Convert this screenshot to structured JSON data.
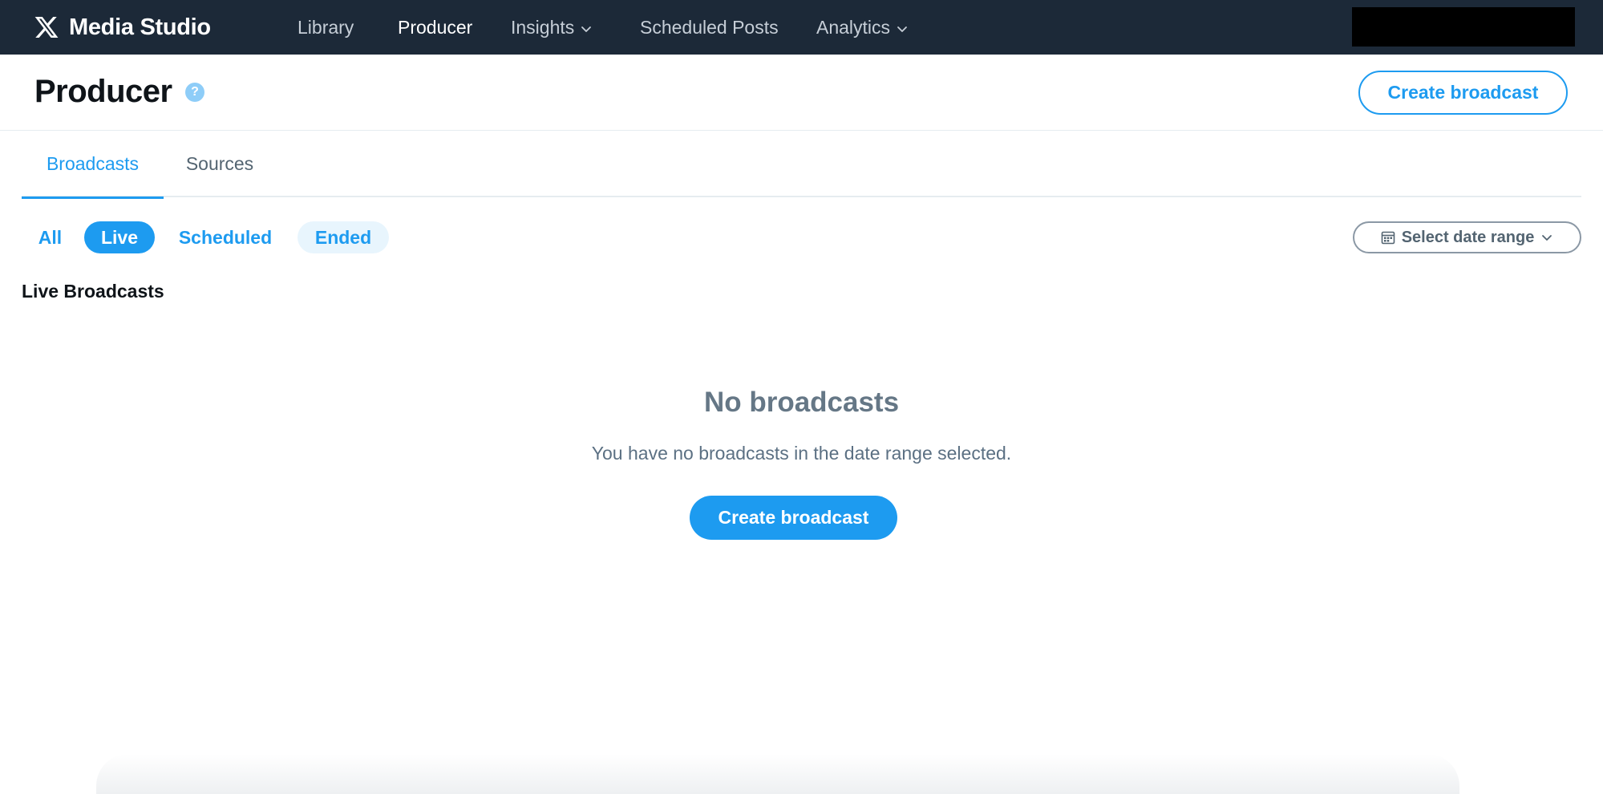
{
  "topnav": {
    "brand": "Media Studio",
    "items": [
      {
        "label": "Library",
        "active": false,
        "dropdown": false
      },
      {
        "label": "Producer",
        "active": true,
        "dropdown": false
      },
      {
        "label": "Insights",
        "active": false,
        "dropdown": true
      },
      {
        "label": "Scheduled Posts",
        "active": false,
        "dropdown": false
      },
      {
        "label": "Analytics",
        "active": false,
        "dropdown": true
      }
    ]
  },
  "header": {
    "title": "Producer",
    "help_symbol": "?",
    "create_label": "Create broadcast"
  },
  "tabs": [
    {
      "label": "Broadcasts",
      "active": true
    },
    {
      "label": "Sources",
      "active": false
    }
  ],
  "filters": [
    {
      "label": "All",
      "state": "default"
    },
    {
      "label": "Live",
      "state": "selected"
    },
    {
      "label": "Scheduled",
      "state": "default"
    },
    {
      "label": "Ended",
      "state": "hover"
    }
  ],
  "date_range": {
    "label": "Select date range"
  },
  "section": {
    "title": "Live Broadcasts"
  },
  "empty_state": {
    "title": "No broadcasts",
    "description": "You have no broadcasts in the date range selected.",
    "button_label": "Create broadcast"
  },
  "colors": {
    "nav_bg": "#1c2938",
    "accent": "#1d9bf0",
    "muted_text": "#536471"
  }
}
